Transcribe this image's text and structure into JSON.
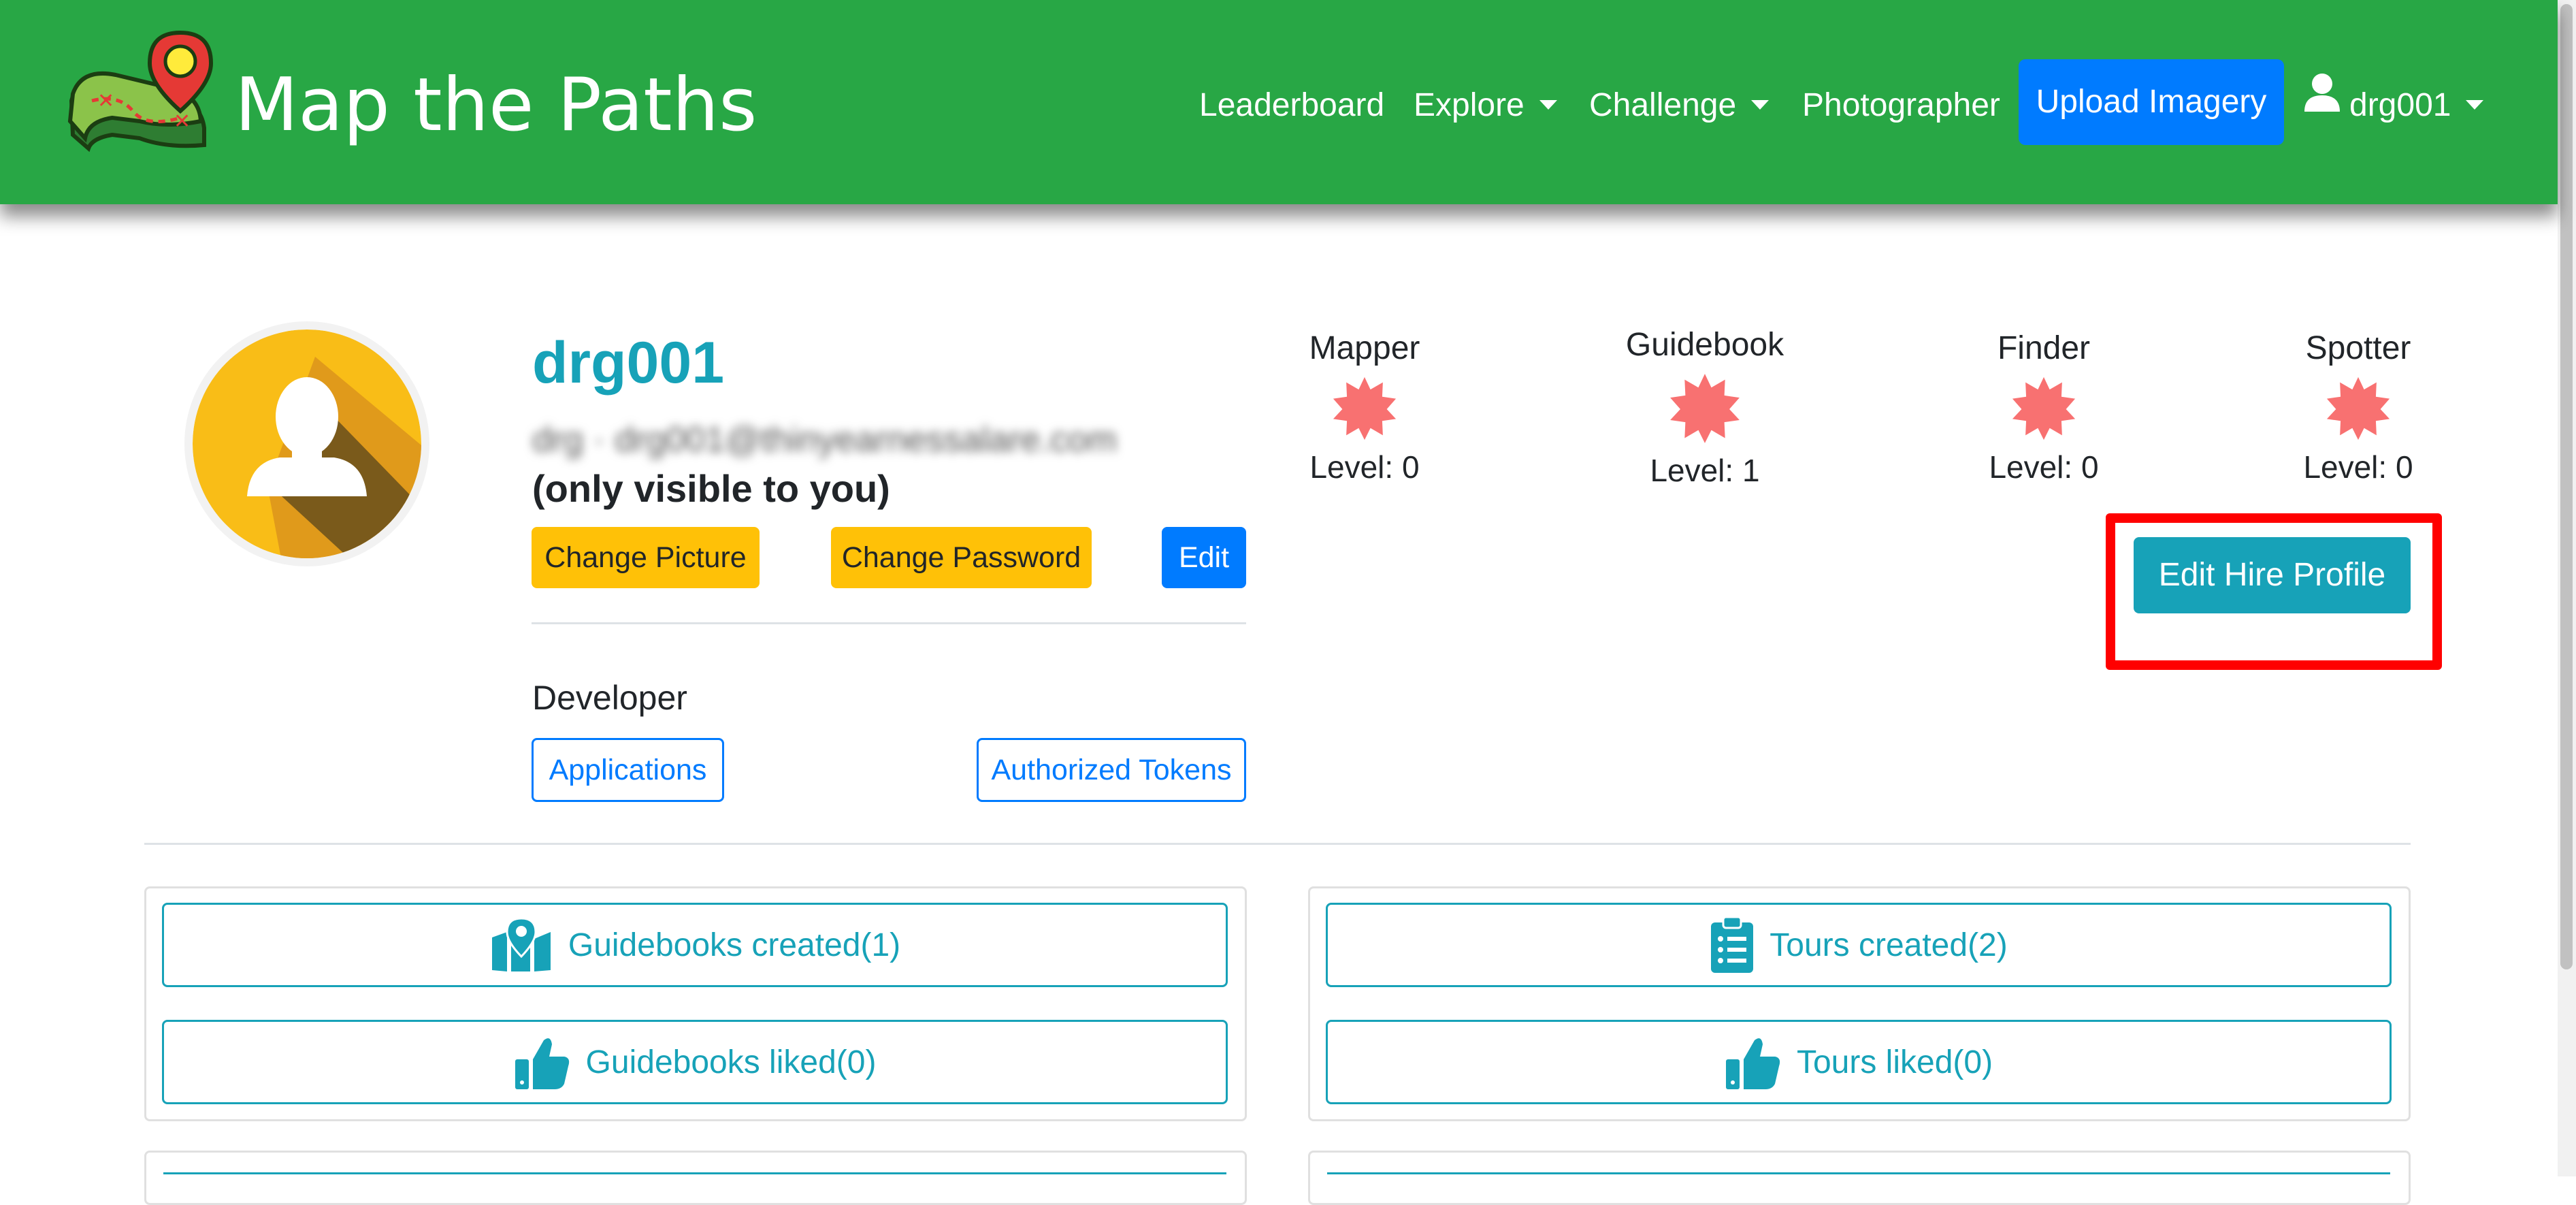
{
  "navbar": {
    "brand": "Map the Paths",
    "links": {
      "leaderboard": "Leaderboard",
      "explore": "Explore",
      "challenge": "Challenge",
      "photographer": "Photographer"
    },
    "upload_button": "Upload Imagery",
    "user_menu": "drg001",
    "color": "#28a745"
  },
  "profile": {
    "username": "drg001",
    "email_blurred": "drg · drg001@thinyearnessalare.com",
    "only_visible": "(only visible to you)",
    "buttons": {
      "change_picture": "Change Picture",
      "change_password": "Change Password",
      "edit": "Edit"
    },
    "developer": {
      "label": "Developer",
      "applications": "Applications",
      "authorized_tokens": "Authorized Tokens"
    }
  },
  "badges": [
    {
      "name": "Mapper",
      "level": "Level: 0"
    },
    {
      "name": "Guidebook",
      "level": "Level: 1"
    },
    {
      "name": "Finder",
      "level": "Level: 0"
    },
    {
      "name": "Spotter",
      "level": "Level: 0"
    }
  ],
  "hire_button": "Edit Hire Profile",
  "cards": {
    "guidebooks_created": "Guidebooks created(1)",
    "guidebooks_liked": "Guidebooks liked(0)",
    "tours_created": "Tours created(2)",
    "tours_liked": "Tours liked(0)"
  },
  "colors": {
    "accent_teal": "#17a2b8",
    "primary_blue": "#007bff",
    "warning_yellow": "#ffc107",
    "badge_red": "#f87171",
    "highlight_red": "#ff0000"
  },
  "icons": [
    "logo-map-icon",
    "user-icon",
    "caret-down-icon",
    "badge-starburst-icon",
    "map-marker-icon",
    "clipboard-list-icon",
    "thumbs-up-icon",
    "avatar-silhouette-icon"
  ]
}
